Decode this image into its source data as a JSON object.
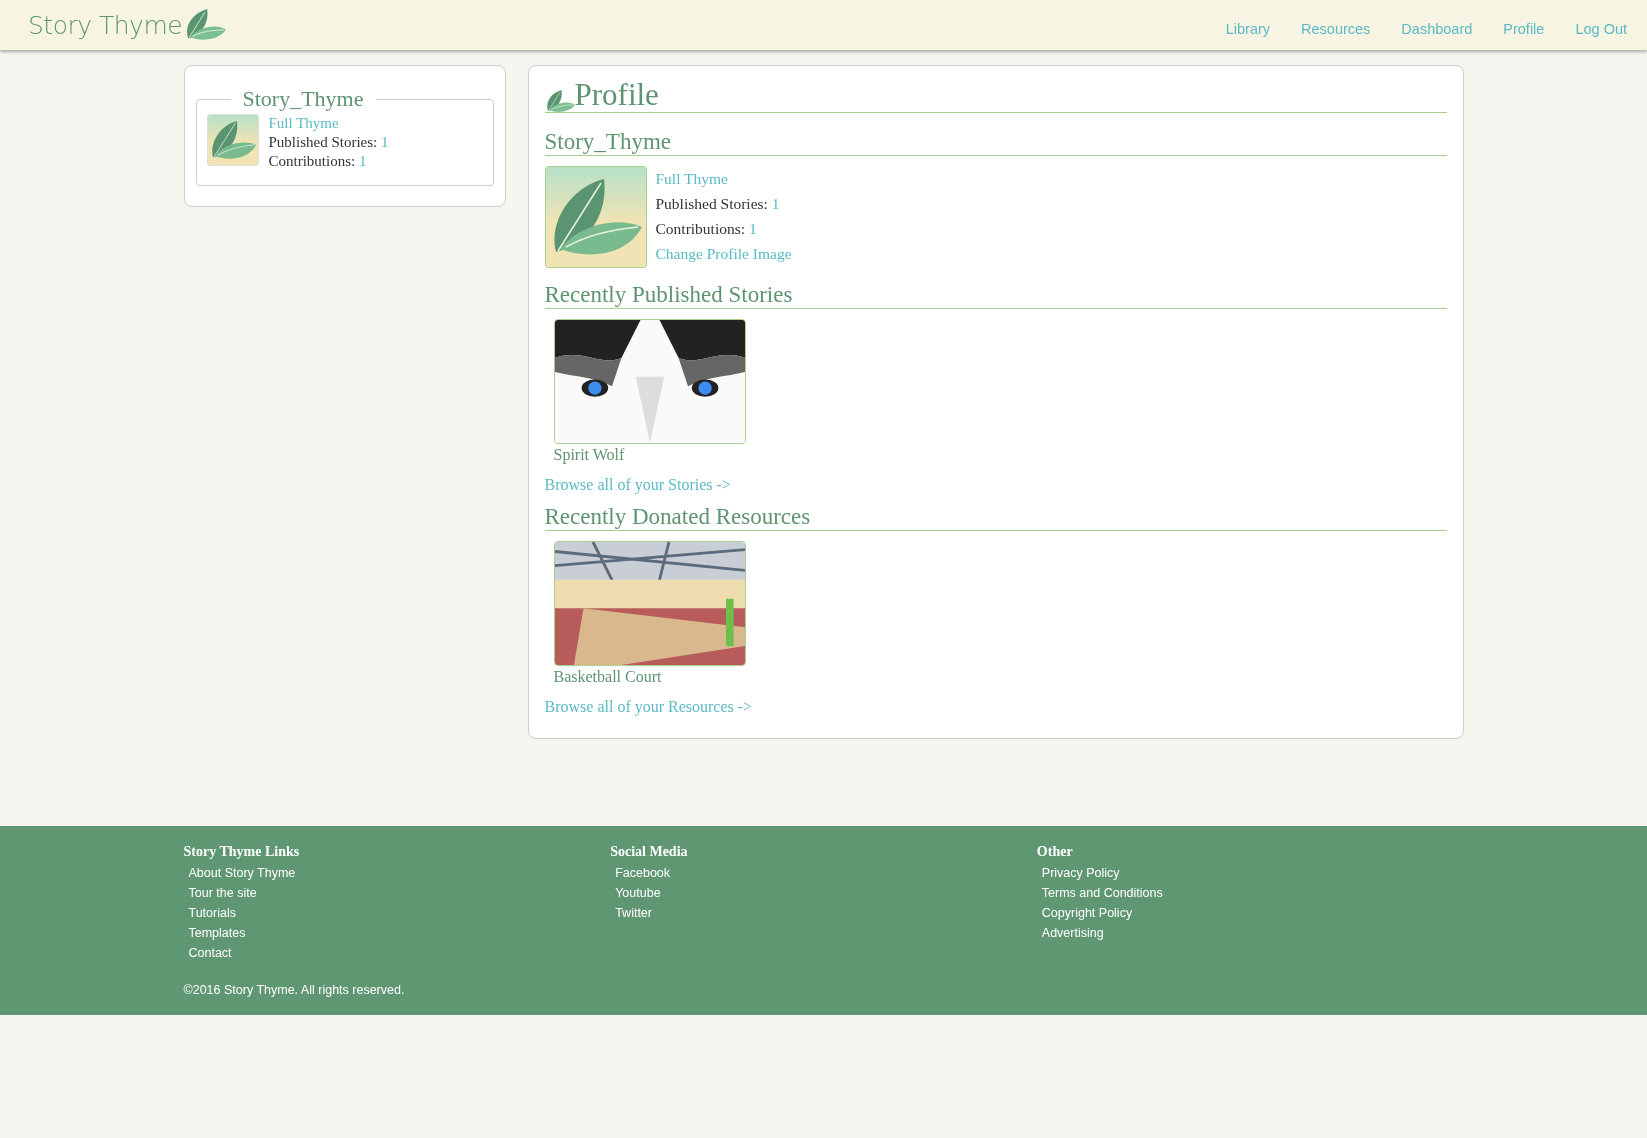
{
  "header": {
    "logo": "Story Thyme",
    "nav": [
      {
        "label": "Library",
        "selected": false
      },
      {
        "label": "Resources",
        "selected": false
      },
      {
        "label": "Dashboard",
        "selected": false
      },
      {
        "label": "Profile",
        "selected": false
      },
      {
        "label": "Log Out",
        "selected": false
      }
    ]
  },
  "sidebar": {
    "username": "Story_Thyme",
    "rank": "Full Thyme",
    "stats": [
      {
        "label": "Published Stories:",
        "value": "1"
      },
      {
        "label": "Contributions:",
        "value": "1"
      }
    ]
  },
  "profile": {
    "title": "Profile",
    "username": "Story_Thyme",
    "rank": "Full Thyme",
    "stats": [
      {
        "label": "Published Stories:",
        "value": "1"
      },
      {
        "label": "Contributions:",
        "value": "1"
      }
    ],
    "change_image": "Change Profile Image",
    "sections": [
      {
        "heading": "Recently Published Stories",
        "items": [
          {
            "title": "Spirit Wolf",
            "kind": "wolf"
          }
        ],
        "browse": "Browse all of your Stories ->"
      },
      {
        "heading": "Recently Donated Resources",
        "items": [
          {
            "title": "Basketball Court",
            "kind": "gym"
          }
        ],
        "browse": "Browse all of your Resources ->"
      }
    ]
  },
  "footer": {
    "columns": [
      {
        "heading": "Story Thyme Links",
        "links": [
          "About Story Thyme",
          "Tour the site",
          "Tutorials",
          "Templates",
          "Contact"
        ]
      },
      {
        "heading": "Social Media",
        "links": [
          "Facebook",
          "Youtube",
          "Twitter"
        ]
      },
      {
        "heading": "Other",
        "links": [
          "Privacy Policy",
          "Terms and Conditions",
          "Copyright Policy",
          "Advertising"
        ]
      }
    ],
    "copyright": "©2016 Story Thyme. All rights reserved."
  }
}
